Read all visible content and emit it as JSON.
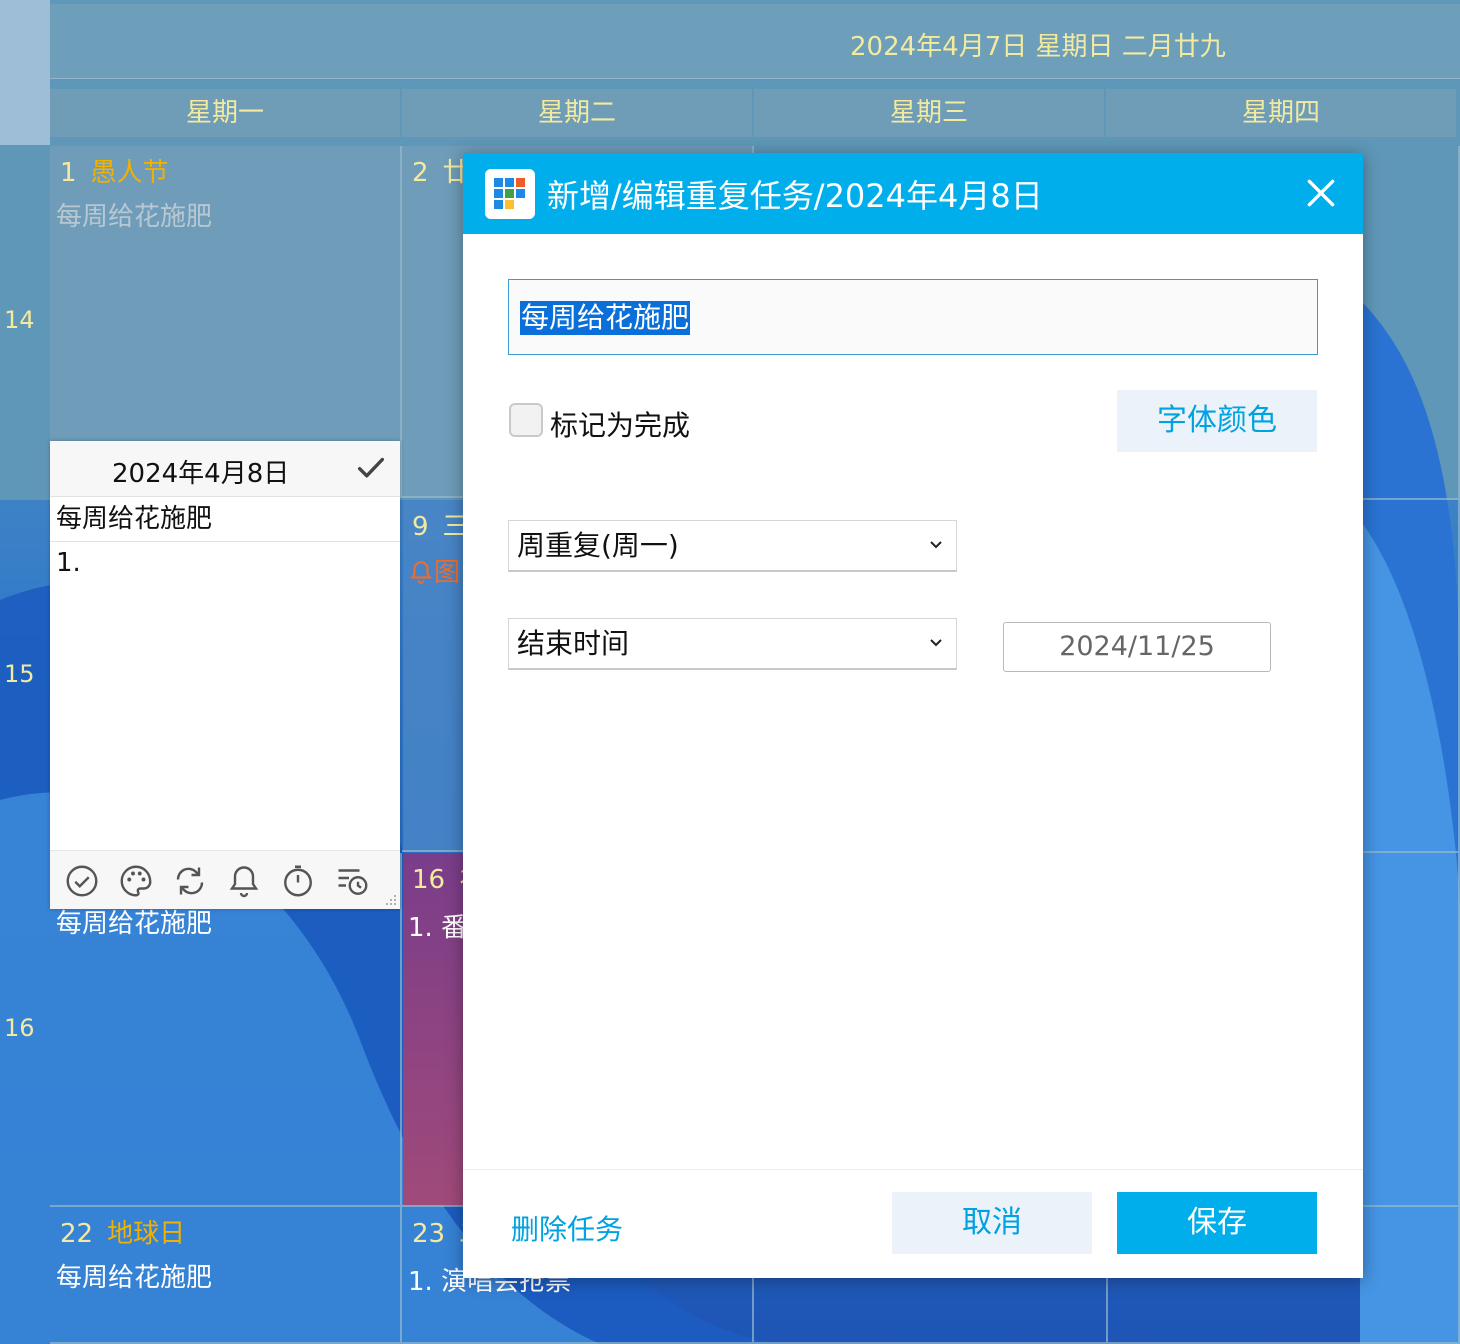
{
  "header": {
    "date_text": "2024年4月7日 星期日 二月廿九"
  },
  "weekdays": [
    "星期一",
    "星期二",
    "星期三",
    "星期四"
  ],
  "week_numbers": [
    "14",
    "15",
    "16"
  ],
  "cells": {
    "apr1": {
      "day": "1",
      "holiday": "愚人节",
      "task": "每周给花施肥"
    },
    "apr2": {
      "day": "2",
      "holiday": "廿"
    },
    "apr9": {
      "day": "9",
      "holiday": "三",
      "reminder": "图"
    },
    "apr15_task": "每周给花施肥",
    "apr16": {
      "day": "16",
      "holiday": "礻",
      "task": "1. 番"
    },
    "apr22": {
      "day": "22",
      "holiday": "地球日",
      "task": "每周给花施肥"
    },
    "apr23": {
      "day": "23",
      "holiday": "二",
      "task": "1. 演唱会抢票"
    }
  },
  "inline_editor": {
    "date": "2024年4月8日",
    "title": "每周给花施肥",
    "body": "1.",
    "tools": [
      "check-icon",
      "palette-icon",
      "repeat-icon",
      "bell-icon",
      "timer-icon",
      "schedule-icon"
    ]
  },
  "dialog": {
    "title": "新增/编辑重复任务/2024年4月8日",
    "task_title": "每周给花施肥",
    "mark_done_label": "标记为完成",
    "mark_done_checked": false,
    "font_color_label": "字体颜色",
    "repeat_select": "周重复(周一)",
    "end_select": "结束时间",
    "end_date": "2024/11/25",
    "delete_label": "删除任务",
    "cancel_label": "取消",
    "save_label": "保存"
  },
  "colors": {
    "accent": "#00aeec",
    "calendar_header": "#6f9db8",
    "calendar_text": "#f3eaa0",
    "holiday": "#f1b100",
    "selection": "#0a6fd9"
  }
}
